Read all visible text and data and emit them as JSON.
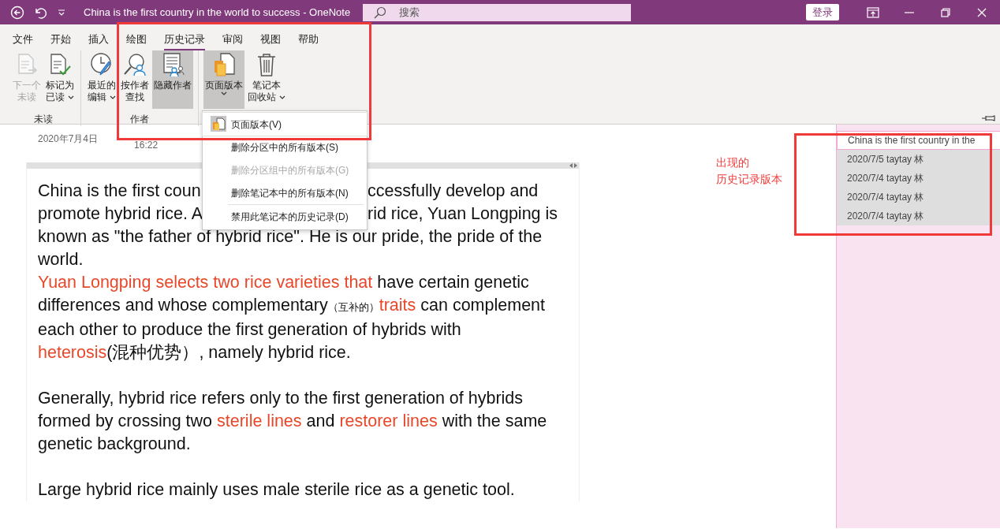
{
  "window": {
    "title": "China is the first country in the world to success  -  OneNote",
    "search": {
      "placeholder": "搜索"
    },
    "sign_in": "登录"
  },
  "ribbon": {
    "tabs": [
      {
        "label": "文件",
        "selected": false
      },
      {
        "label": "开始",
        "selected": false
      },
      {
        "label": "插入",
        "selected": false
      },
      {
        "label": "绘图",
        "selected": false
      },
      {
        "label": "历史记录",
        "selected": true
      },
      {
        "label": "审阅",
        "selected": false
      },
      {
        "label": "视图",
        "selected": false
      },
      {
        "label": "帮助",
        "selected": false
      }
    ],
    "groups": [
      {
        "label": "未读",
        "buttons": [
          {
            "label_lines": [
              "下一个",
              "未读"
            ],
            "disabled": true,
            "pressed": false,
            "dropdown": false
          },
          {
            "label_lines": [
              "标记为",
              "已读"
            ],
            "disabled": false,
            "pressed": false,
            "dropdown": true
          }
        ]
      },
      {
        "label": "作者",
        "buttons": [
          {
            "label_lines": [
              "最近的",
              "编辑"
            ],
            "disabled": false,
            "pressed": false,
            "dropdown": true
          },
          {
            "label_lines": [
              "按作者",
              "查找"
            ],
            "disabled": false,
            "pressed": false,
            "dropdown": false
          },
          {
            "label_lines": [
              "隐藏作者"
            ],
            "disabled": false,
            "pressed": true,
            "dropdown": false
          }
        ]
      },
      {
        "buttons": [
          {
            "label_lines": [
              "页面版本"
            ],
            "disabled": false,
            "pressed": true,
            "dropdown": true
          },
          {
            "label_lines": [
              "笔记本",
              "回收站"
            ],
            "disabled": false,
            "pressed": false,
            "dropdown": true
          }
        ]
      }
    ]
  },
  "menu": [
    {
      "label": "页面版本(V)",
      "disabled": false,
      "icon": true
    },
    {
      "label": "删除分区中的所有版本(S)",
      "disabled": false,
      "icon": false
    },
    {
      "label": "删除分区组中的所有版本(G)",
      "disabled": true,
      "icon": false
    },
    {
      "label": "删除笔记本中的所有版本(N)",
      "disabled": false,
      "icon": false
    },
    {
      "label": "禁用此笔记本的历史记录(D)",
      "disabled": false,
      "icon": false,
      "separator_before": true
    }
  ],
  "note": {
    "date": "2020年7月4日",
    "time": "16:22",
    "paragraphs": [
      {
        "lines": [
          {
            "kind": "split",
            "parts": [
              {
                "text": "China is the first coun",
                "kind": "plain"
              },
              {
                "text": "ccessfully develop and",
                "kind": "plain"
              }
            ]
          },
          {
            "kind": "split",
            "parts": [
              {
                "text": "promote hybrid rice. A",
                "kind": "plain"
              },
              {
                "text": "rid rice, Yuan Longping is",
                "kind": "plain"
              }
            ]
          },
          {
            "kind": "flow",
            "parts": [
              {
                "text": "known as \"the father of hybrid rice\". He is our pride, the pride of the",
                "kind": "plain"
              }
            ]
          },
          {
            "kind": "flow",
            "parts": [
              {
                "text": "world.",
                "kind": "plain"
              }
            ]
          },
          {
            "kind": "flow",
            "parts": [
              {
                "text": "Yuan Longping selects two rice varieties that",
                "kind": "highlight"
              },
              {
                "text": " have certain genetic",
                "kind": "plain"
              }
            ]
          },
          {
            "kind": "flow",
            "parts": [
              {
                "text": "differences and whose complementary",
                "kind": "plain"
              },
              {
                "text": "（互补的）",
                "kind": "small"
              },
              {
                "text": "traits",
                "kind": "highlight"
              },
              {
                "text": " can complement",
                "kind": "plain"
              }
            ]
          },
          {
            "kind": "flow",
            "parts": [
              {
                "text": "each other to produce the first generation of hybrids with",
                "kind": "plain"
              }
            ]
          },
          {
            "kind": "flow",
            "parts": [
              {
                "text": "heterosis",
                "kind": "highlight"
              },
              {
                "text": "(混种优势）, namely hybrid rice.",
                "kind": "plain"
              }
            ]
          }
        ]
      },
      {
        "lines": [
          {
            "kind": "flow",
            "parts": [
              {
                "text": "Generally, hybrid rice refers only to the first generation of hybrids",
                "kind": "plain"
              }
            ]
          },
          {
            "kind": "flow",
            "parts": [
              {
                "text": "formed by crossing two ",
                "kind": "plain"
              },
              {
                "text": "sterile lines",
                "kind": "highlight"
              },
              {
                "text": " and ",
                "kind": "plain"
              },
              {
                "text": "restorer lines",
                "kind": "highlight"
              },
              {
                "text": " with the same",
                "kind": "plain"
              }
            ]
          },
          {
            "kind": "flow",
            "parts": [
              {
                "text": "genetic background.",
                "kind": "plain"
              }
            ]
          }
        ]
      },
      {
        "lines": [
          {
            "kind": "flow",
            "parts": [
              {
                "text": "Large hybrid rice mainly uses male sterile rice as a genetic tool.",
                "kind": "plain"
              }
            ]
          }
        ]
      }
    ]
  },
  "pages": [
    {
      "text": "China is the first country in the",
      "kind": "page",
      "selected": true
    },
    {
      "text": "2020/7/5 taytay 林",
      "kind": "version",
      "selected": false
    },
    {
      "text": "2020/7/4 taytay 林",
      "kind": "version",
      "selected": false
    },
    {
      "text": "2020/7/4 taytay 林",
      "kind": "version",
      "selected": false
    },
    {
      "text": "2020/7/4 taytay 林",
      "kind": "version",
      "selected": false
    }
  ],
  "annotation": {
    "lines": [
      "出现的",
      "历史记录版本"
    ]
  }
}
